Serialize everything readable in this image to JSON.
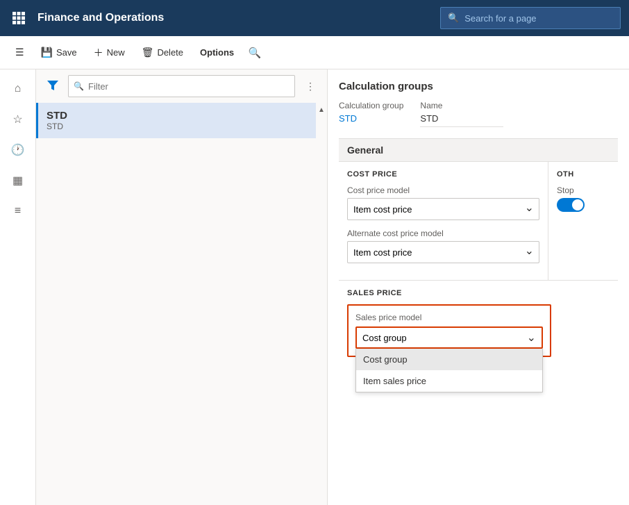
{
  "topNav": {
    "appTitle": "Finance and Operations",
    "searchPlaceholder": "Search for a page"
  },
  "toolbar": {
    "saveLabel": "Save",
    "newLabel": "New",
    "deleteLabel": "Delete",
    "optionsLabel": "Options"
  },
  "listPanel": {
    "filterPlaceholder": "Filter",
    "items": [
      {
        "title": "STD",
        "subtitle": "STD"
      }
    ]
  },
  "detailPanel": {
    "sectionTitle": "Calculation groups",
    "calculationGroupLabel": "Calculation group",
    "calculationGroupValue": "STD",
    "nameLabel": "Name",
    "nameValue": "STD",
    "generalLabel": "General",
    "costPriceHeader": "COST PRICE",
    "otherHeader": "OTH",
    "costPriceModelLabel": "Cost price model",
    "costPriceModelValue": "Item cost price",
    "alternateCostPriceModelLabel": "Alternate cost price model",
    "alternateCostPriceModelValue": "Item cost price",
    "stopLabel": "Stop",
    "salesPriceHeader": "SALES PRICE",
    "salesPriceModelLabel": "Sales price model",
    "salesPriceModelSelected": "Cost group",
    "salesPriceDropdownOptions": [
      {
        "label": "Cost group",
        "highlighted": true
      },
      {
        "label": "Item sales price",
        "highlighted": false
      }
    ]
  }
}
